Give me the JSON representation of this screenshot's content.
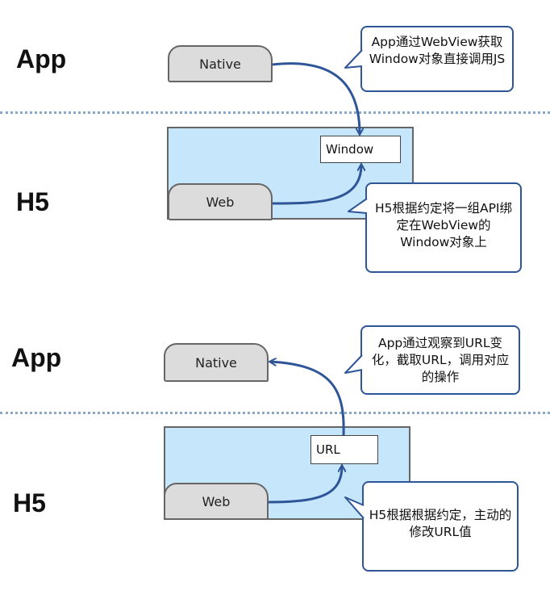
{
  "top": {
    "app_label": "App",
    "h5_label": "H5",
    "native_label": "Native",
    "web_label": "Web",
    "window_label": "Window",
    "note_app": "App通过WebView获取Window对象直接调用JS",
    "note_h5": "H5根据约定将一组API绑定在WebView的Window对象上"
  },
  "bottom": {
    "app_label": "App",
    "h5_label": "H5",
    "native_label": "Native",
    "web_label": "Web",
    "url_label": "URL",
    "note_app": "App通过观察到URL变化，截取URL，调用对应的操作",
    "note_h5": "H5根据根据约定，主动的修改URL值"
  },
  "colors": {
    "panel": "#c6e6fb",
    "tab": "#dcdcdc",
    "arrow": "#2e5597",
    "note_border": "#2e5597",
    "divider": "#8aa6c6"
  }
}
